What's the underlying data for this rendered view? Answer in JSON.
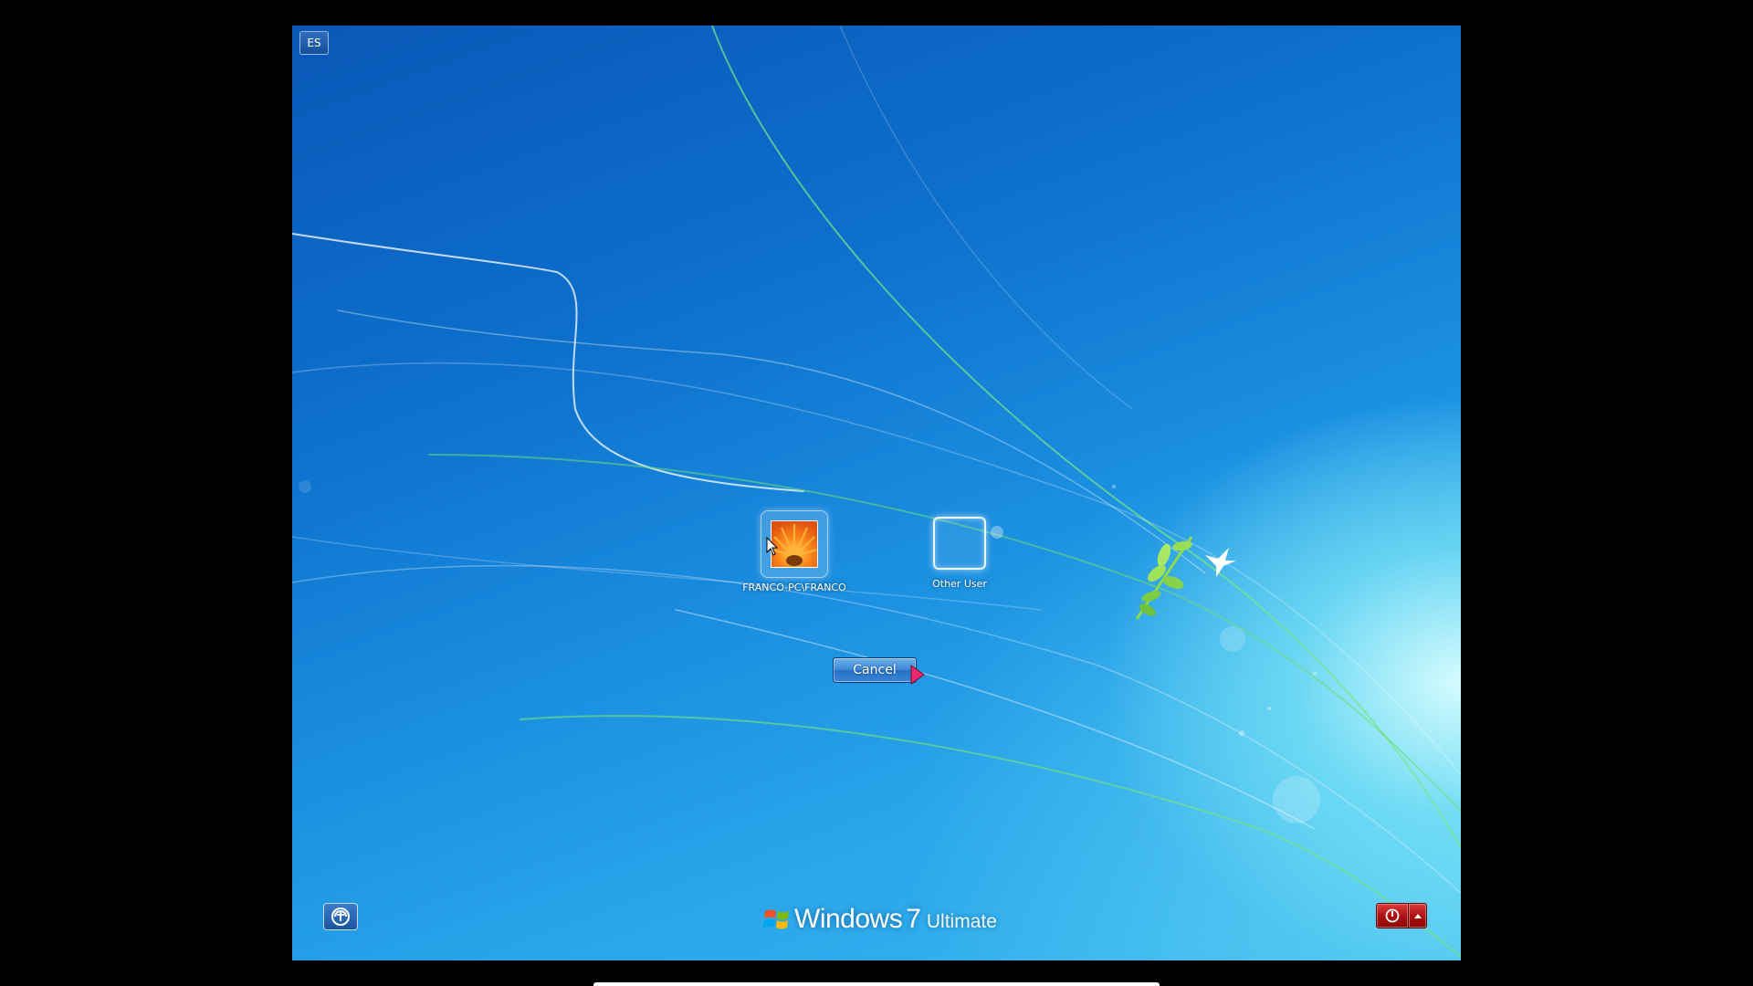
{
  "screen": {
    "language_indicator": "ES",
    "users": [
      {
        "name": "FRANCO-PC\\FRANCO",
        "picture": "orange-flower-picture"
      },
      {
        "name": "Other User",
        "picture": "blank-picture"
      }
    ],
    "cancel_label": "Cancel",
    "ease_of_access_icon": "ease-of-access-icon",
    "branding": {
      "name": "Windows",
      "version": "7",
      "edition": "Ultimate"
    },
    "shutdown_icon": "power-icon",
    "shutdown_options_icon": "triangle-up-icon"
  },
  "colors": {
    "background_top": "#0a58b8",
    "background_glow": "#b8f2fb",
    "power_button": "#b81414"
  }
}
